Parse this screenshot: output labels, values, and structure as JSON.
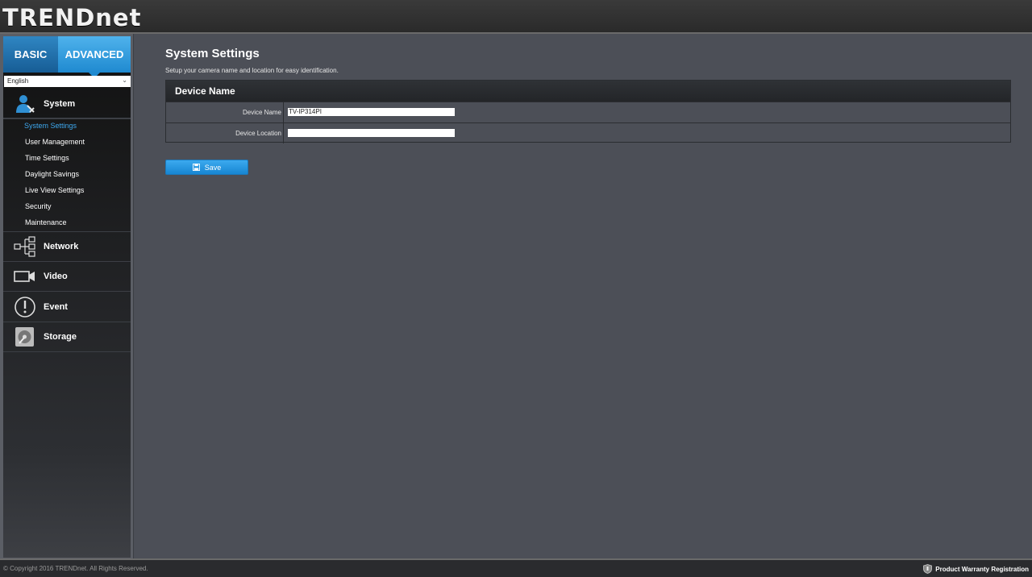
{
  "header": {
    "logo_text": "TRENDnet"
  },
  "sidebar": {
    "tabs": [
      {
        "label": "BASIC"
      },
      {
        "label": "ADVANCED"
      }
    ],
    "language": "English",
    "nav": [
      {
        "label": "System",
        "icon": "user-settings-icon"
      },
      {
        "label": "Network",
        "icon": "network-icon"
      },
      {
        "label": "Video",
        "icon": "video-camera-icon"
      },
      {
        "label": "Event",
        "icon": "alert-icon"
      },
      {
        "label": "Storage",
        "icon": "storage-icon"
      }
    ],
    "system_items": [
      {
        "label": "System Settings",
        "active": true
      },
      {
        "label": "User Management"
      },
      {
        "label": "Time Settings"
      },
      {
        "label": "Daylight Savings"
      },
      {
        "label": "Live View Settings"
      },
      {
        "label": "Security"
      },
      {
        "label": "Maintenance"
      }
    ]
  },
  "main": {
    "title": "System Settings",
    "description": "Setup your camera name and location for easy identification.",
    "panel_title": "Device Name",
    "fields": [
      {
        "label": "Device Name",
        "value": "TV-IP314PI"
      },
      {
        "label": "Device Location",
        "value": ""
      }
    ],
    "save_label": "Save"
  },
  "footer": {
    "copyright": "© Copyright 2016 TRENDnet. All Rights Reserved.",
    "warranty": "Product Warranty Registration"
  },
  "colors": {
    "accent": "#1f8ad0",
    "active_link": "#3ea8ee",
    "background": "#4c4f57"
  }
}
